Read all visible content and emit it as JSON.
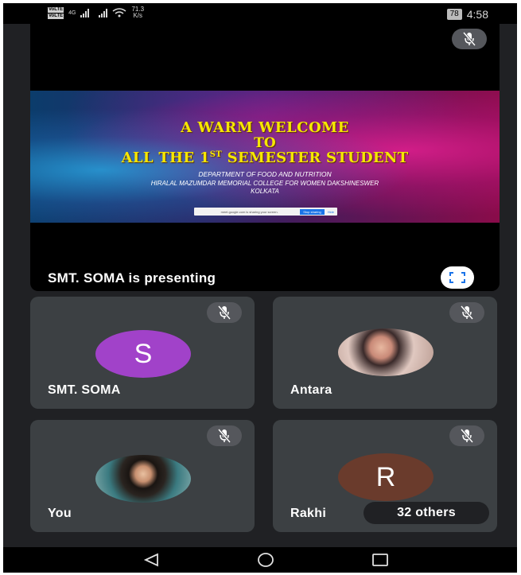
{
  "status_bar": {
    "sim1": "VoLTE",
    "sim2": "VoLTE",
    "network": "4G",
    "speed_value": "71.3",
    "speed_unit": "K/s",
    "battery": "78",
    "time": "4:58"
  },
  "presentation": {
    "slide": {
      "line1": "A WARM WELCOME",
      "line2": "TO",
      "line3_prefix": "ALL THE 1",
      "line3_sup": "ST",
      "line3_suffix": " SEMESTER STUDENT",
      "department": "DEPARTMENT OF FOOD AND NUTRITION",
      "college": "HIRALAL MAZUMDAR MEMORIAL COLLEGE FOR WOMEN DAKSHINESWER",
      "city": "KOLKATA",
      "share_message": "meet.google.com is sharing your screen.",
      "stop_sharing": "Stop sharing",
      "hide": "Hide"
    },
    "presenting_label": "SMT. SOMA is presenting"
  },
  "participants": [
    {
      "name": "SMT. SOMA",
      "initial": "S",
      "avatar_color": "#a142c9"
    },
    {
      "name": "Antara",
      "initial": ""
    },
    {
      "name": "You",
      "initial": ""
    },
    {
      "name": "Rakhi",
      "initial": "R",
      "avatar_color": "#6a3b2c"
    }
  ],
  "others_label": "32 others",
  "icons": {
    "mic": "mic-off-icon",
    "fullscreen": "fullscreen-icon",
    "back": "back-triangle-icon",
    "home": "home-circle-icon",
    "recents": "recents-square-icon"
  }
}
